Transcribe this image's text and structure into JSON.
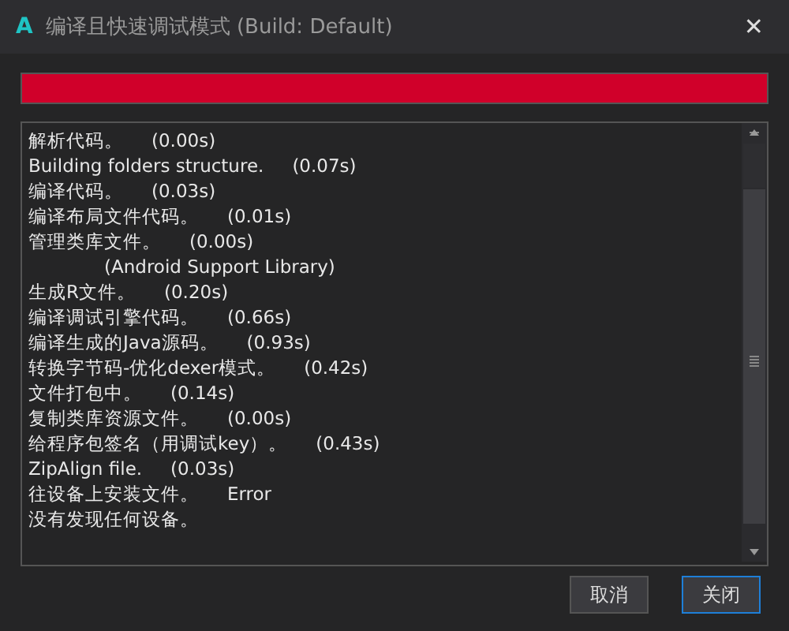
{
  "window": {
    "logo": "A",
    "title": "编译且快速调试模式 (Build: Default)",
    "close": "✕"
  },
  "progress": {
    "level": 1
  },
  "log": [
    {
      "kind": "entry",
      "text": "解析代码。",
      "time": "(0.00s)"
    },
    {
      "kind": "entry",
      "text": "Building folders structure.",
      "time": "(0.07s)"
    },
    {
      "kind": "entry",
      "text": "编译代码。",
      "time": "(0.03s)"
    },
    {
      "kind": "entry",
      "text": "编译布局文件代码。",
      "time": "(0.01s)"
    },
    {
      "kind": "entry",
      "text": "管理类库文件。",
      "time": "(0.00s)"
    },
    {
      "kind": "indent",
      "text": "(Android Support Library)"
    },
    {
      "kind": "entry",
      "text": "生成R文件。",
      "time": "(0.20s)"
    },
    {
      "kind": "entry",
      "text": "编译调试引擎代码。",
      "time": "(0.66s)"
    },
    {
      "kind": "entry",
      "text": "编译生成的Java源码。",
      "time": "(0.93s)"
    },
    {
      "kind": "entry",
      "text": "转换字节码-优化dexer模式。",
      "time": "(0.42s)"
    },
    {
      "kind": "entry",
      "text": "文件打包中。",
      "time": "(0.14s)"
    },
    {
      "kind": "entry",
      "text": "复制类库资源文件。",
      "time": "(0.00s)"
    },
    {
      "kind": "entry",
      "text": "给程序包签名（用调试key）。",
      "time": "(0.43s)"
    },
    {
      "kind": "entry",
      "text": "ZipAlign file.",
      "time": "(0.03s)"
    },
    {
      "kind": "entry",
      "text": "往设备上安装文件。",
      "time": "Error"
    },
    {
      "kind": "entry",
      "text": "没有发现任何设备。"
    }
  ],
  "buttons": [
    {
      "label": "取消",
      "selected": false
    },
    {
      "label": "关闭",
      "selected": true
    }
  ]
}
